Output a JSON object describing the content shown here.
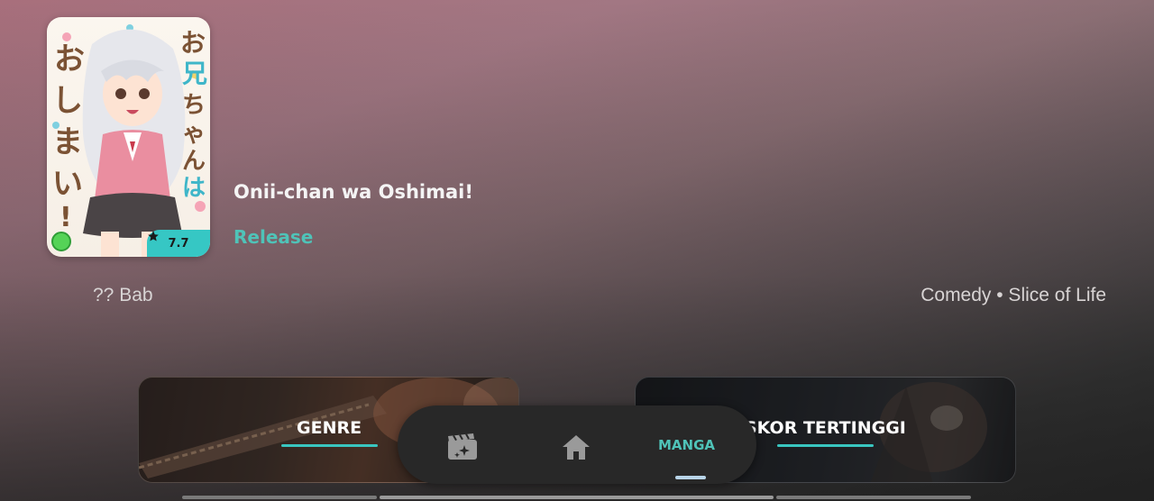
{
  "item": {
    "title": "Onii-chan wa Oshimai!",
    "status": "Release",
    "chapters": "?? Bab",
    "genres": "Comedy • Slice of Life",
    "score": "7.7"
  },
  "cards": {
    "genre_label": "GENRE",
    "score_label": "SKOR TERTINGGI"
  },
  "nav": {
    "manga_label": "MANGA",
    "active": "MANGA"
  },
  "colors": {
    "accent": "#36c7c4",
    "status_green": "#55d357",
    "nav_bg": "#282828"
  },
  "icons": {
    "star": "star-icon",
    "anime": "clapperboard-sparkle-icon",
    "home": "home-icon"
  }
}
